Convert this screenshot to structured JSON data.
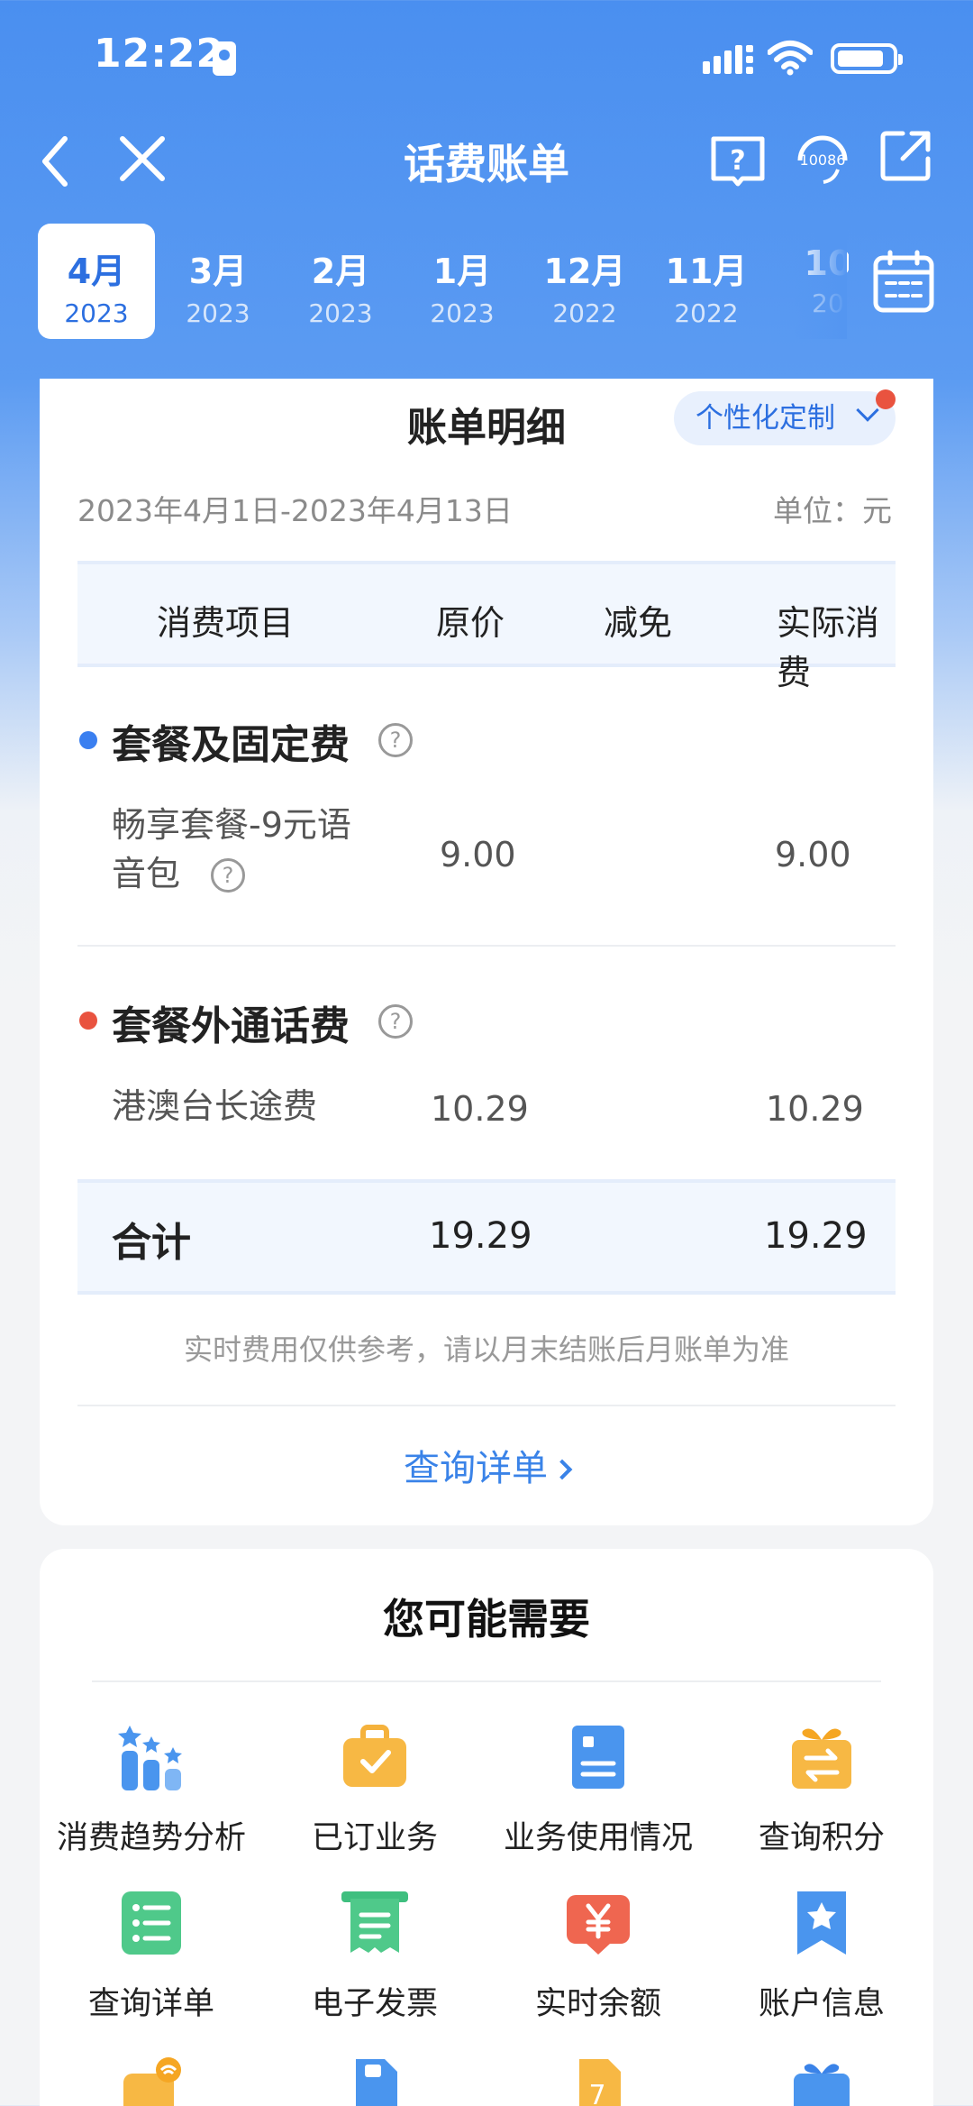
{
  "status_bar": {
    "time": "12:22"
  },
  "nav": {
    "title": "话费账单",
    "service_number": "10086"
  },
  "months": [
    {
      "month": "4月",
      "year": "2023",
      "active": true
    },
    {
      "month": "3月",
      "year": "2023"
    },
    {
      "month": "2月",
      "year": "2023"
    },
    {
      "month": "1月",
      "year": "2023"
    },
    {
      "month": "12月",
      "year": "2022"
    },
    {
      "month": "11月",
      "year": "2022"
    },
    {
      "month": "10",
      "year": "20"
    }
  ],
  "bill": {
    "title": "账单明细",
    "custom_label": "个性化定制",
    "date_range": "2023年4月1日-2023年4月13日",
    "unit": "单位：元",
    "columns": [
      "消费项目",
      "原价",
      "减免",
      "实际消费"
    ],
    "sections": [
      {
        "title": "套餐及固定费",
        "dot_color": "#3a7ff0",
        "items": [
          {
            "name_line1": "畅享套餐-9元语",
            "name_line2": "音包",
            "price": "9.00",
            "discount": "",
            "actual": "9.00"
          }
        ]
      },
      {
        "title": "套餐外通话费",
        "dot_color": "#e9533f",
        "items": [
          {
            "name": "港澳台长途费",
            "price": "10.29",
            "discount": "",
            "actual": "10.29"
          }
        ]
      }
    ],
    "total": {
      "label": "合计",
      "price": "19.29",
      "actual": "19.29"
    },
    "note": "实时费用仅供参考，请以月末结账后月账单为准",
    "detail_link": "查询详单"
  },
  "suggest": {
    "title": "您可能需要",
    "items": [
      {
        "label": "消费趋势分析",
        "icon": "trend-chart-icon"
      },
      {
        "label": "已订业务",
        "icon": "briefcase-check-icon"
      },
      {
        "label": "业务使用情况",
        "icon": "document-icon"
      },
      {
        "label": "查询积分",
        "icon": "gift-exchange-icon"
      },
      {
        "label": "查询详单",
        "icon": "list-icon"
      },
      {
        "label": "电子发票",
        "icon": "invoice-icon"
      },
      {
        "label": "实时余额",
        "icon": "yuan-wallet-icon"
      },
      {
        "label": "账户信息",
        "icon": "bookmark-star-icon"
      }
    ]
  }
}
